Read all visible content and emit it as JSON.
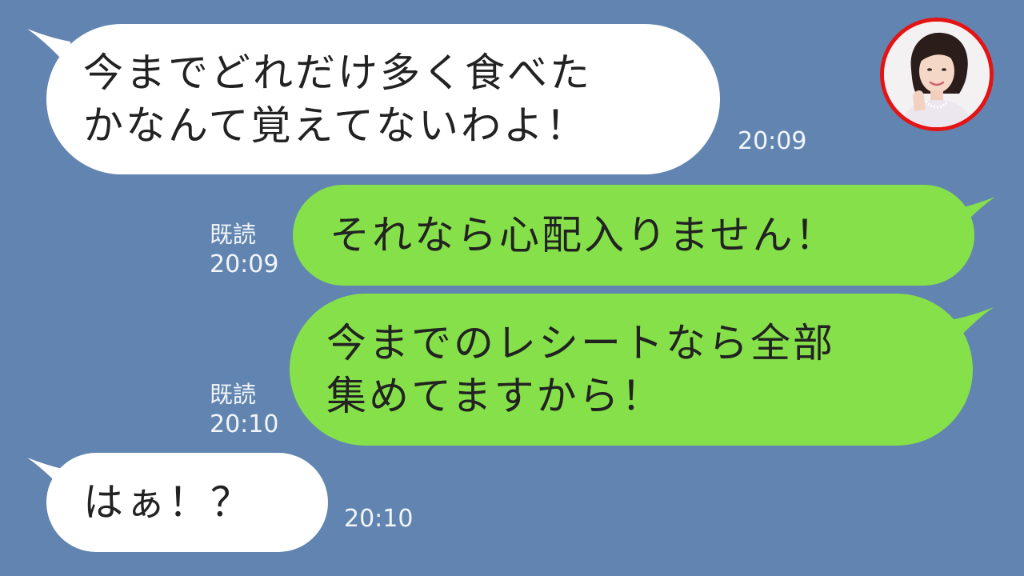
{
  "messages": [
    {
      "id": "m1",
      "direction": "incoming",
      "lines": [
        "今までどれだけ多く食べた",
        "かなんて覚えてないわよ！"
      ],
      "time": "20:09"
    },
    {
      "id": "m2",
      "direction": "outgoing",
      "lines": [
        "それなら心配入りません！"
      ],
      "read_label": "既読",
      "time": "20:09"
    },
    {
      "id": "m3",
      "direction": "outgoing",
      "lines": [
        "今までのレシートなら全部",
        "集めてますから！"
      ],
      "read_label": "既読",
      "time": "20:10"
    },
    {
      "id": "m4",
      "direction": "incoming",
      "lines": [
        "はぁ！？"
      ],
      "time": "20:10"
    }
  ],
  "avatar": {
    "icon": "user-photo",
    "ring_color": "#e41414"
  },
  "colors": {
    "background": "#6185b0",
    "incoming_bubble": "#ffffff",
    "outgoing_bubble": "#86e049",
    "text": "#222222",
    "meta_text": "#f2f5fa"
  }
}
